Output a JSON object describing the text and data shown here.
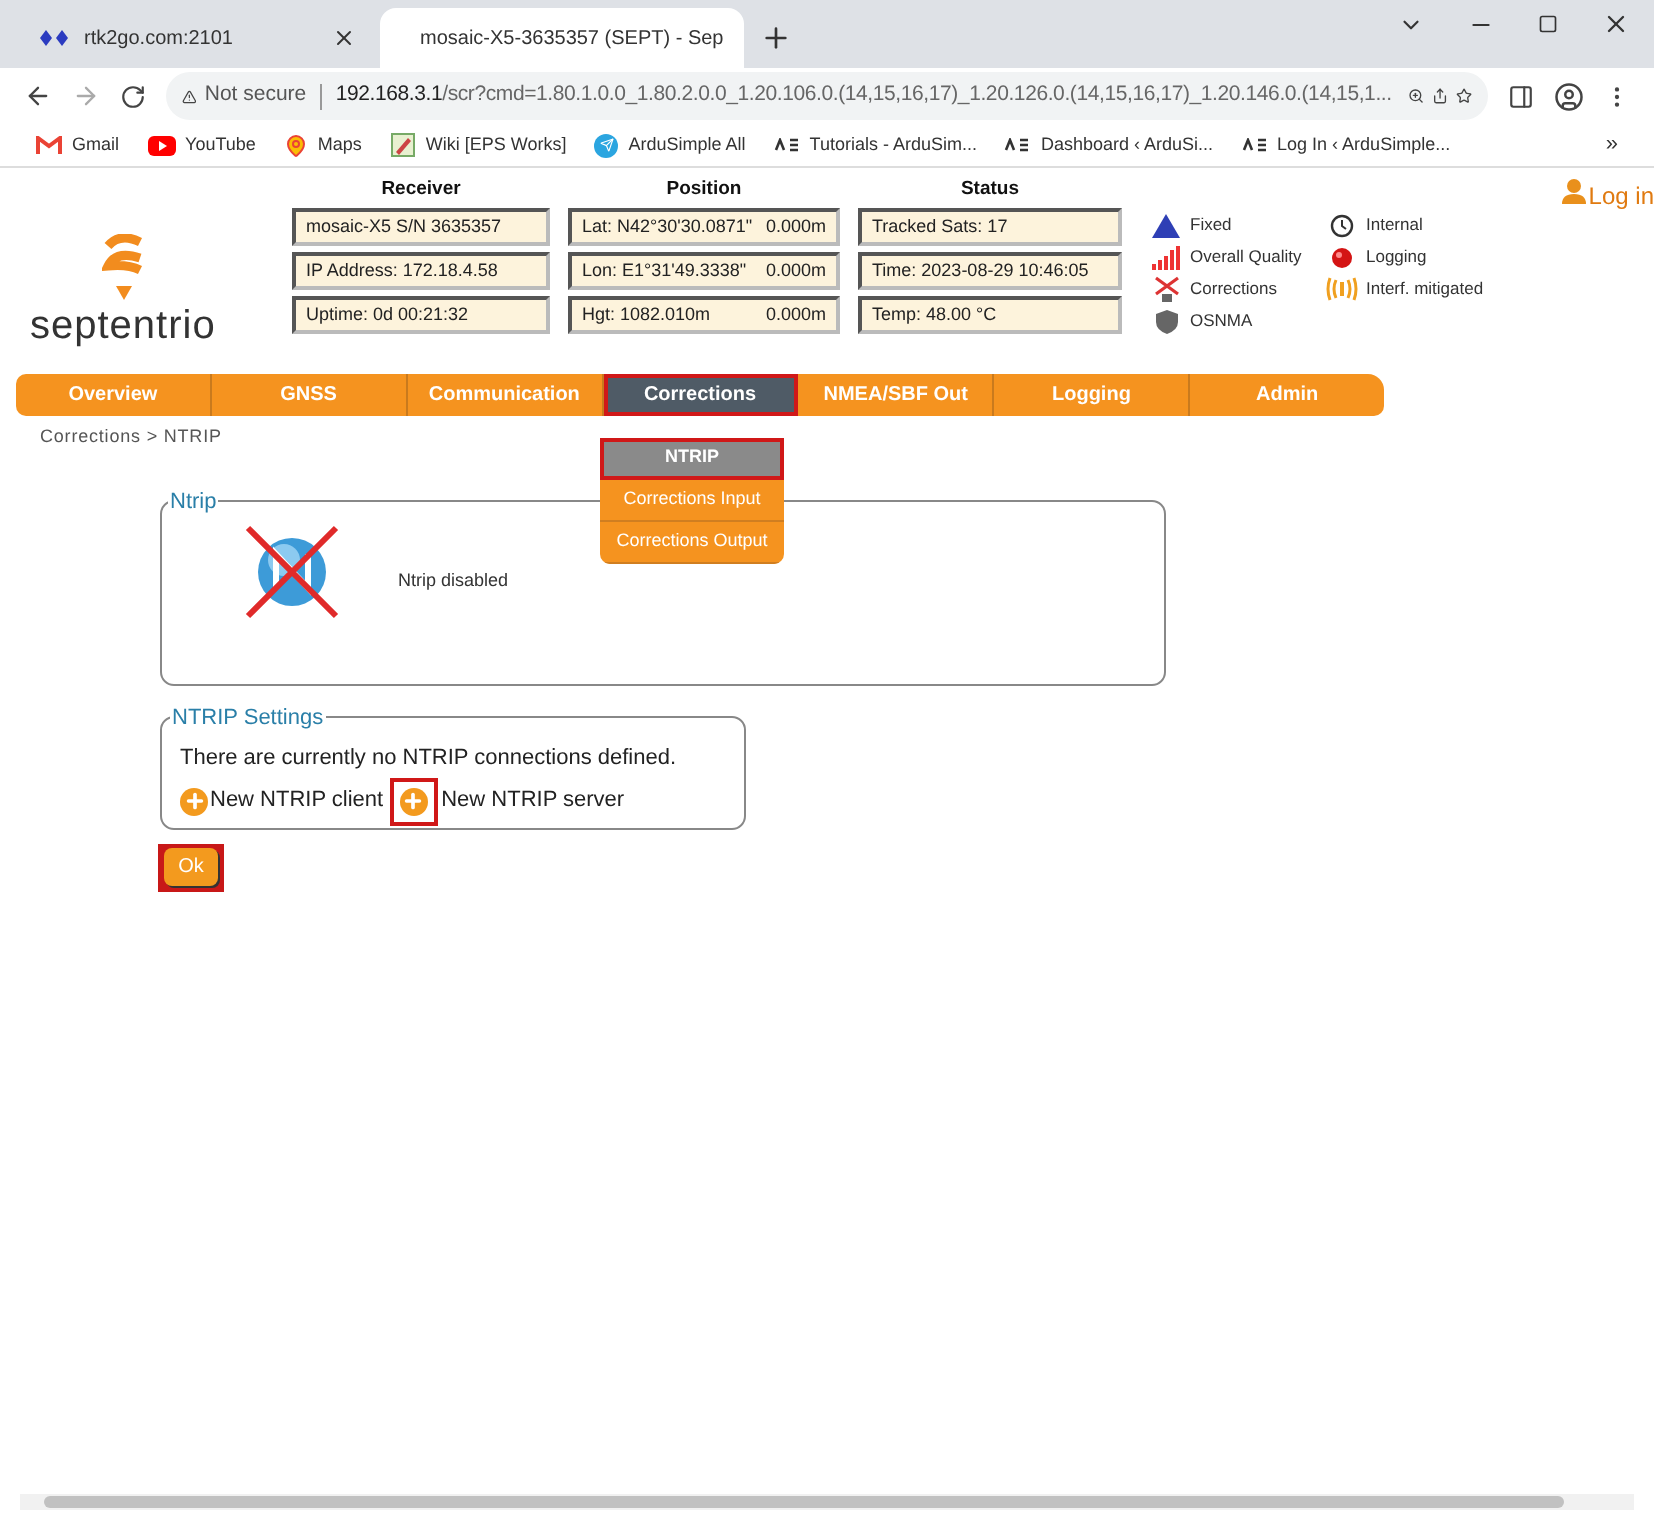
{
  "browser": {
    "tabs": [
      {
        "title": "rtk2go.com:2101",
        "selected": false
      },
      {
        "title": "mosaic-X5-3635357 (SEPT) - Sep",
        "selected": true
      }
    ],
    "address": {
      "warning": "Not secure",
      "host": "192.168.3.1",
      "path": "/scr?cmd=1.80.1.0.0_1.80.2.0.0_1.20.106.0.(14,15,16,17)_1.20.126.0.(14,15,16,17)_1.20.146.0.(14,15,1..."
    },
    "bookmarks": [
      "Gmail",
      "YouTube",
      "Maps",
      "Wiki [EPS Works]",
      "ArduSimple All",
      "Tutorials - ArduSim...",
      "Dashboard ‹ ArduSi...",
      "Log In ‹ ArduSimple..."
    ],
    "bookmarks_more": "»"
  },
  "header": {
    "logo_text": "septentrio",
    "login": "Log in",
    "columns": [
      {
        "title": "Receiver",
        "cells": [
          "mosaic-X5 S/N 3635357",
          "IP Address: 172.18.4.58",
          "Uptime: 0d 00:21:32"
        ]
      },
      {
        "title": "Position",
        "cells": [
          [
            "Lat:  N42°30'30.0871\"",
            "0.000m"
          ],
          [
            "Lon: E1°31'49.3338\"",
            "0.000m"
          ],
          [
            "Hgt: 1082.010m",
            "0.000m"
          ]
        ]
      },
      {
        "title": "Status",
        "cells": [
          "Tracked Sats: 17",
          "Time: 2023-08-29 10:46:05",
          "Temp: 48.00 °C"
        ]
      }
    ],
    "legend": [
      {
        "kind": "fixed",
        "label": "Fixed"
      },
      {
        "kind": "clock",
        "label": "Internal"
      },
      {
        "kind": "quality",
        "label": "Overall Quality"
      },
      {
        "kind": "logging",
        "label": "Logging"
      },
      {
        "kind": "corrections",
        "label": "Corrections"
      },
      {
        "kind": "interference",
        "label": "Interf. mitigated"
      },
      {
        "kind": "osnma",
        "label": "OSNMA"
      }
    ]
  },
  "nav": [
    {
      "label": "Overview",
      "selected": false,
      "highlighted": false
    },
    {
      "label": "GNSS",
      "selected": false,
      "highlighted": false
    },
    {
      "label": "Communication",
      "selected": false,
      "highlighted": false
    },
    {
      "label": "Corrections",
      "selected": true,
      "highlighted": true
    },
    {
      "label": "NMEA/SBF Out",
      "selected": false,
      "highlighted": false
    },
    {
      "label": "Logging",
      "selected": false,
      "highlighted": false
    },
    {
      "label": "Admin",
      "selected": false,
      "highlighted": false
    }
  ],
  "submenu": [
    {
      "label": "NTRIP",
      "selected": true,
      "highlighted": true
    },
    {
      "label": "Corrections Input",
      "selected": false,
      "highlighted": false
    },
    {
      "label": "Corrections Output",
      "selected": false,
      "highlighted": false
    }
  ],
  "breadcrumb": "Corrections > NTRIP",
  "ntrip_panel": {
    "legend": "Ntrip",
    "status": "Ntrip disabled",
    "disabled": true
  },
  "settings_panel": {
    "legend": "NTRIP Settings",
    "message": "There are currently no NTRIP connections defined.",
    "actions": [
      {
        "label": "New NTRIP client",
        "highlighted": false
      },
      {
        "label": "New NTRIP server",
        "highlighted": true
      }
    ]
  },
  "ok_button": {
    "label": "Ok",
    "highlighted": true
  }
}
